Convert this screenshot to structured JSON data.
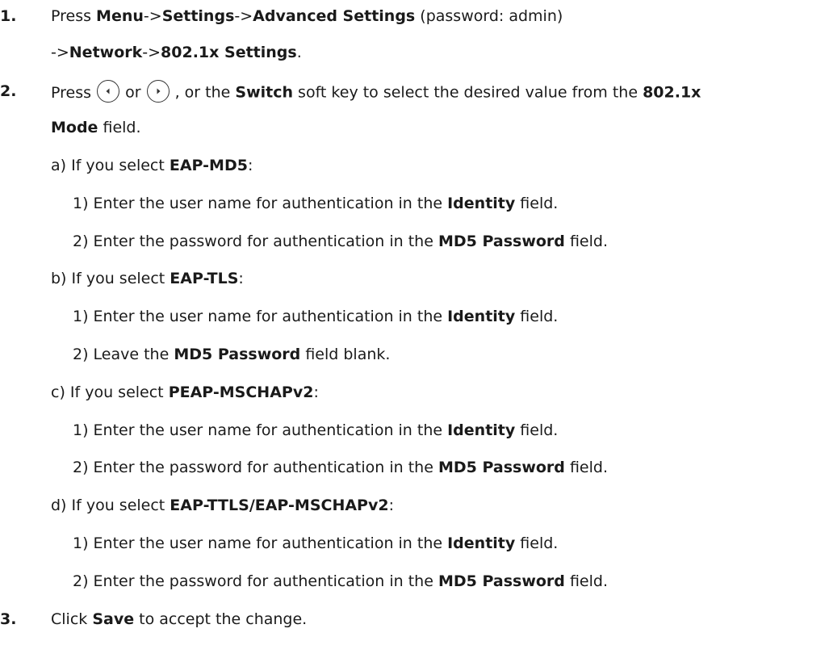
{
  "steps": [
    {
      "number": "1.",
      "line1": {
        "a": "Press ",
        "b": "Menu",
        "c": "->",
        "d": "Settings",
        "e": "->",
        "f": "Advanced Settings",
        "g": " (password: admin)"
      },
      "line2": {
        "a": "->",
        "b": "Network",
        "c": "->",
        "d": "802.1x Settings",
        "e": "."
      }
    },
    {
      "number": "2.",
      "line1": {
        "a": "Press ",
        "or": " or ",
        "b": " , or the ",
        "switch": "Switch",
        "c": " soft key to select the desired value from the ",
        "mode1": "802.1x"
      },
      "line2": {
        "mode2": "Mode",
        "a": " field."
      }
    },
    {
      "number": "3.",
      "line": {
        "a": "Click ",
        "b": "Save",
        "c": " to accept the change."
      }
    }
  ],
  "options": [
    {
      "prefix": "a) If you select ",
      "mode": "EAP-MD5",
      "suffix": ":",
      "items": [
        {
          "a": "1) Enter the user name for authentication in the ",
          "b": "Identity",
          "c": " field."
        },
        {
          "a": "2) Enter the password for authentication in the ",
          "b": "MD5 Password",
          "c": " field."
        }
      ]
    },
    {
      "prefix": "b) If you select ",
      "mode": "EAP-TLS",
      "suffix": ":",
      "items": [
        {
          "a": "1) Enter the user name for authentication in the ",
          "b": "Identity",
          "c": " field."
        },
        {
          "a": "2) Leave the ",
          "b": "MD5 Password",
          "c": " field blank."
        }
      ]
    },
    {
      "prefix": "c) If you select ",
      "mode": "PEAP-MSCHAPv2",
      "suffix": ":",
      "items": [
        {
          "a": "1) Enter the user name for authentication in the ",
          "b": "Identity",
          "c": " field."
        },
        {
          "a": "2) Enter the password for authentication in the ",
          "b": "MD5 Password",
          "c": " field."
        }
      ]
    },
    {
      "prefix": "d) If you select ",
      "mode": "EAP-TTLS/EAP-MSCHAPv2",
      "suffix": ":",
      "items": [
        {
          "a": "1) Enter the user name for authentication in the ",
          "b": "Identity",
          "c": " field."
        },
        {
          "a": "2) Enter the password for authentication in the ",
          "b": "MD5 Password",
          "c": " field."
        }
      ]
    }
  ],
  "icons": {
    "left": "left-arrow-key-icon",
    "right": "right-arrow-key-icon"
  }
}
